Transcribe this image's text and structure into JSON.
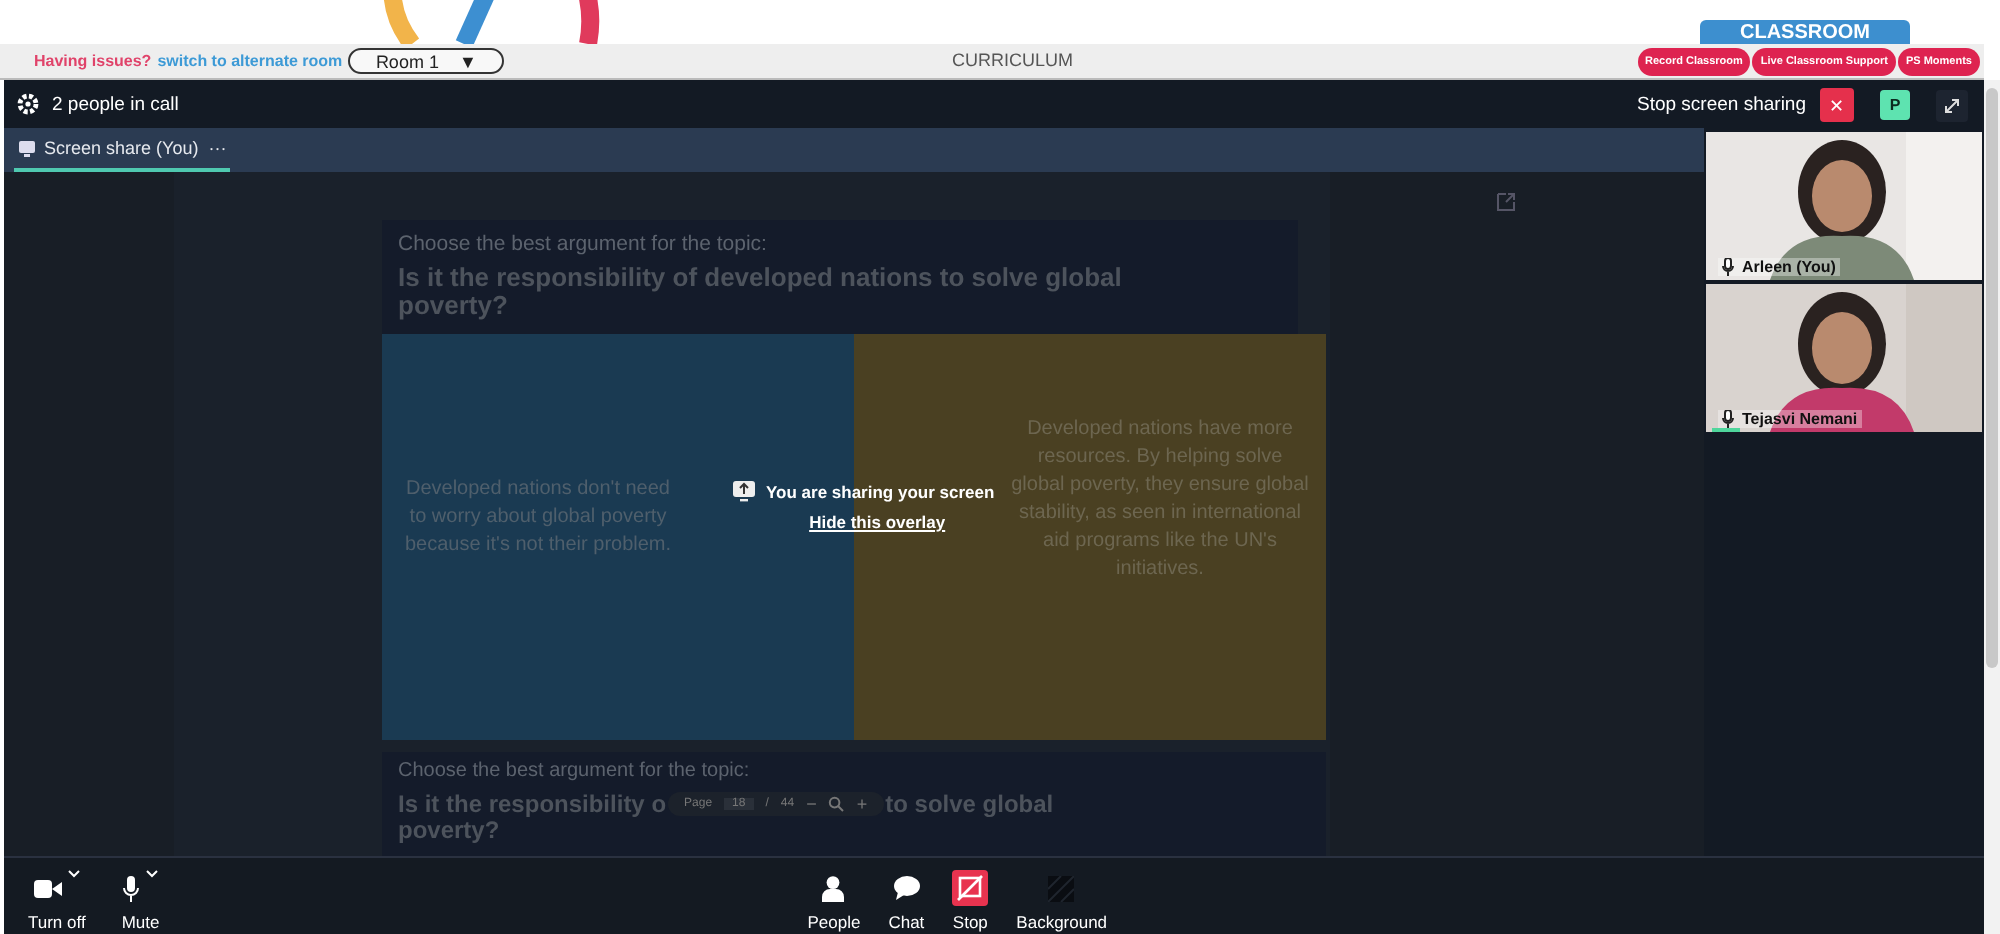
{
  "top_bar": {
    "issue_text": "Having issues?",
    "switch_link": "switch to alternate room",
    "room_select": "Room 1",
    "room_caret": "▼",
    "title": "CURRICULUM",
    "classroom_tab": "CLASSROOM",
    "actions": [
      "Record Classroom",
      "Live Classroom Support",
      "PS Moments"
    ]
  },
  "call_header": {
    "people_count": "2 people in call",
    "stop_label": "Stop screen sharing",
    "close_glyph": "✕",
    "avatar_letter": "P"
  },
  "tabs": [
    {
      "label": "Screen share (You)",
      "selected": true,
      "more": "···"
    }
  ],
  "slide": {
    "cards": [
      {
        "prompt": "Choose the best argument for the topic:",
        "question": "Is it the responsibility of developed nations to solve global poverty?"
      }
    ],
    "options": [
      {
        "text": "Developed nations don't need to worry about global poverty because it's not their problem.",
        "color": "#1a3a52"
      },
      {
        "text": "Developed nations have more resources. By helping solve global poverty, they ensure global stability, as seen in international aid programs like the UN's initiatives.",
        "color": "#4a4022"
      }
    ],
    "next_card": {
      "prompt": "Choose the best argument for the topic:",
      "question_start": "Is it the responsibility o",
      "question_end": "to solve global",
      "question_last": "poverty?"
    },
    "pager": {
      "label": "Page",
      "page": "18",
      "separator": "/",
      "total": "44",
      "zoom_out": "−",
      "zoom_in": "+"
    }
  },
  "share_overlay": {
    "message": "You are sharing your screen",
    "hide_link": "Hide this overlay"
  },
  "participants": [
    {
      "name": "Arleen (You)",
      "speaking": false
    },
    {
      "name": "Tejasvi Nemani",
      "speaking": true
    }
  ],
  "controls_left": [
    {
      "label": "Turn off",
      "kind": "camera"
    },
    {
      "label": "Mute",
      "kind": "mic"
    }
  ],
  "controls_center": [
    {
      "label": "People",
      "kind": "people"
    },
    {
      "label": "Chat",
      "kind": "chat"
    },
    {
      "label": "Stop",
      "kind": "stop"
    },
    {
      "label": "Background",
      "kind": "background"
    }
  ]
}
